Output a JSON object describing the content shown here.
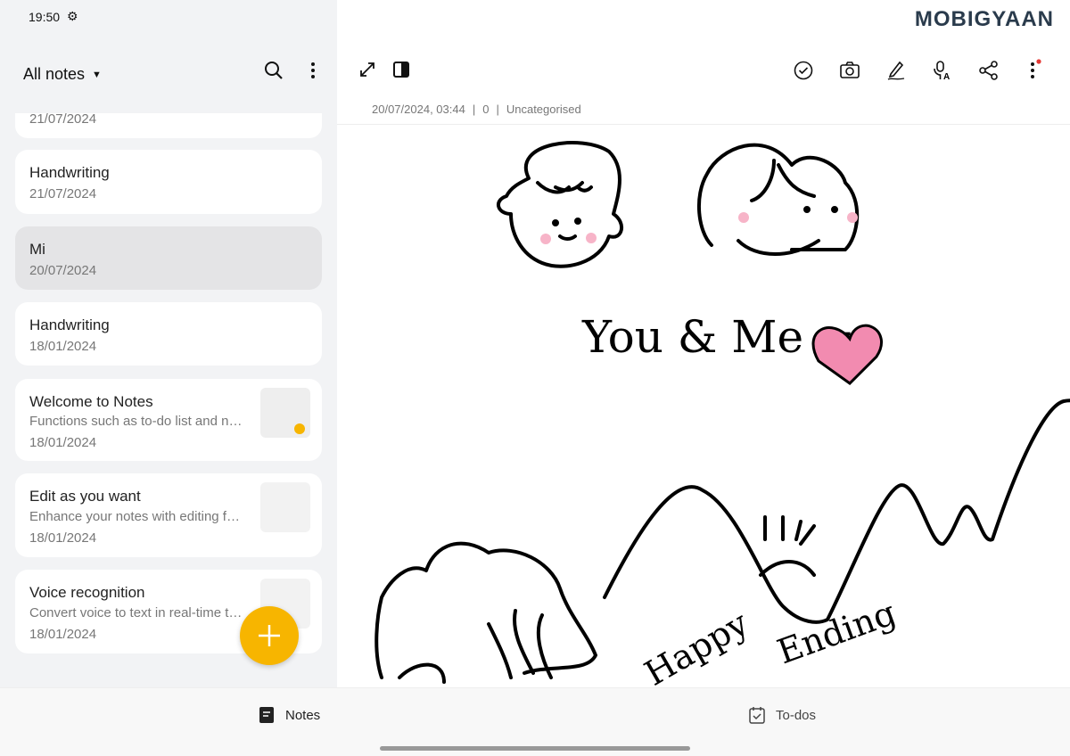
{
  "status": {
    "time": "19:50",
    "settings_icon": "gear-icon"
  },
  "sidebar": {
    "title": "All notes",
    "partial_date": "21/07/2024",
    "notes": [
      {
        "title": "Handwriting",
        "date": "21/07/2024"
      },
      {
        "title": "Mi",
        "date": "20/07/2024",
        "selected": true
      },
      {
        "title": "Handwriting",
        "date": "18/01/2024"
      },
      {
        "title": "Welcome to Notes",
        "preview": "Functions such as to-do list and n…",
        "date": "18/01/2024"
      },
      {
        "title": "Edit as you want",
        "preview": "Enhance your notes with editing f…",
        "date": "18/01/2024"
      },
      {
        "title": "Voice recognition",
        "preview": "Convert voice to text in real-time t…",
        "date": "18/01/2024"
      }
    ]
  },
  "editor": {
    "date": "20/07/2024, 03:44",
    "word_count": "0",
    "category": "Uncategorised",
    "drawing_text": [
      "You & Me =",
      "Happy",
      "Ending"
    ]
  },
  "watermark": "MOBIGYAAN",
  "accent": "#f7b500",
  "nav": {
    "notes": "Notes",
    "todos": "To-dos"
  }
}
